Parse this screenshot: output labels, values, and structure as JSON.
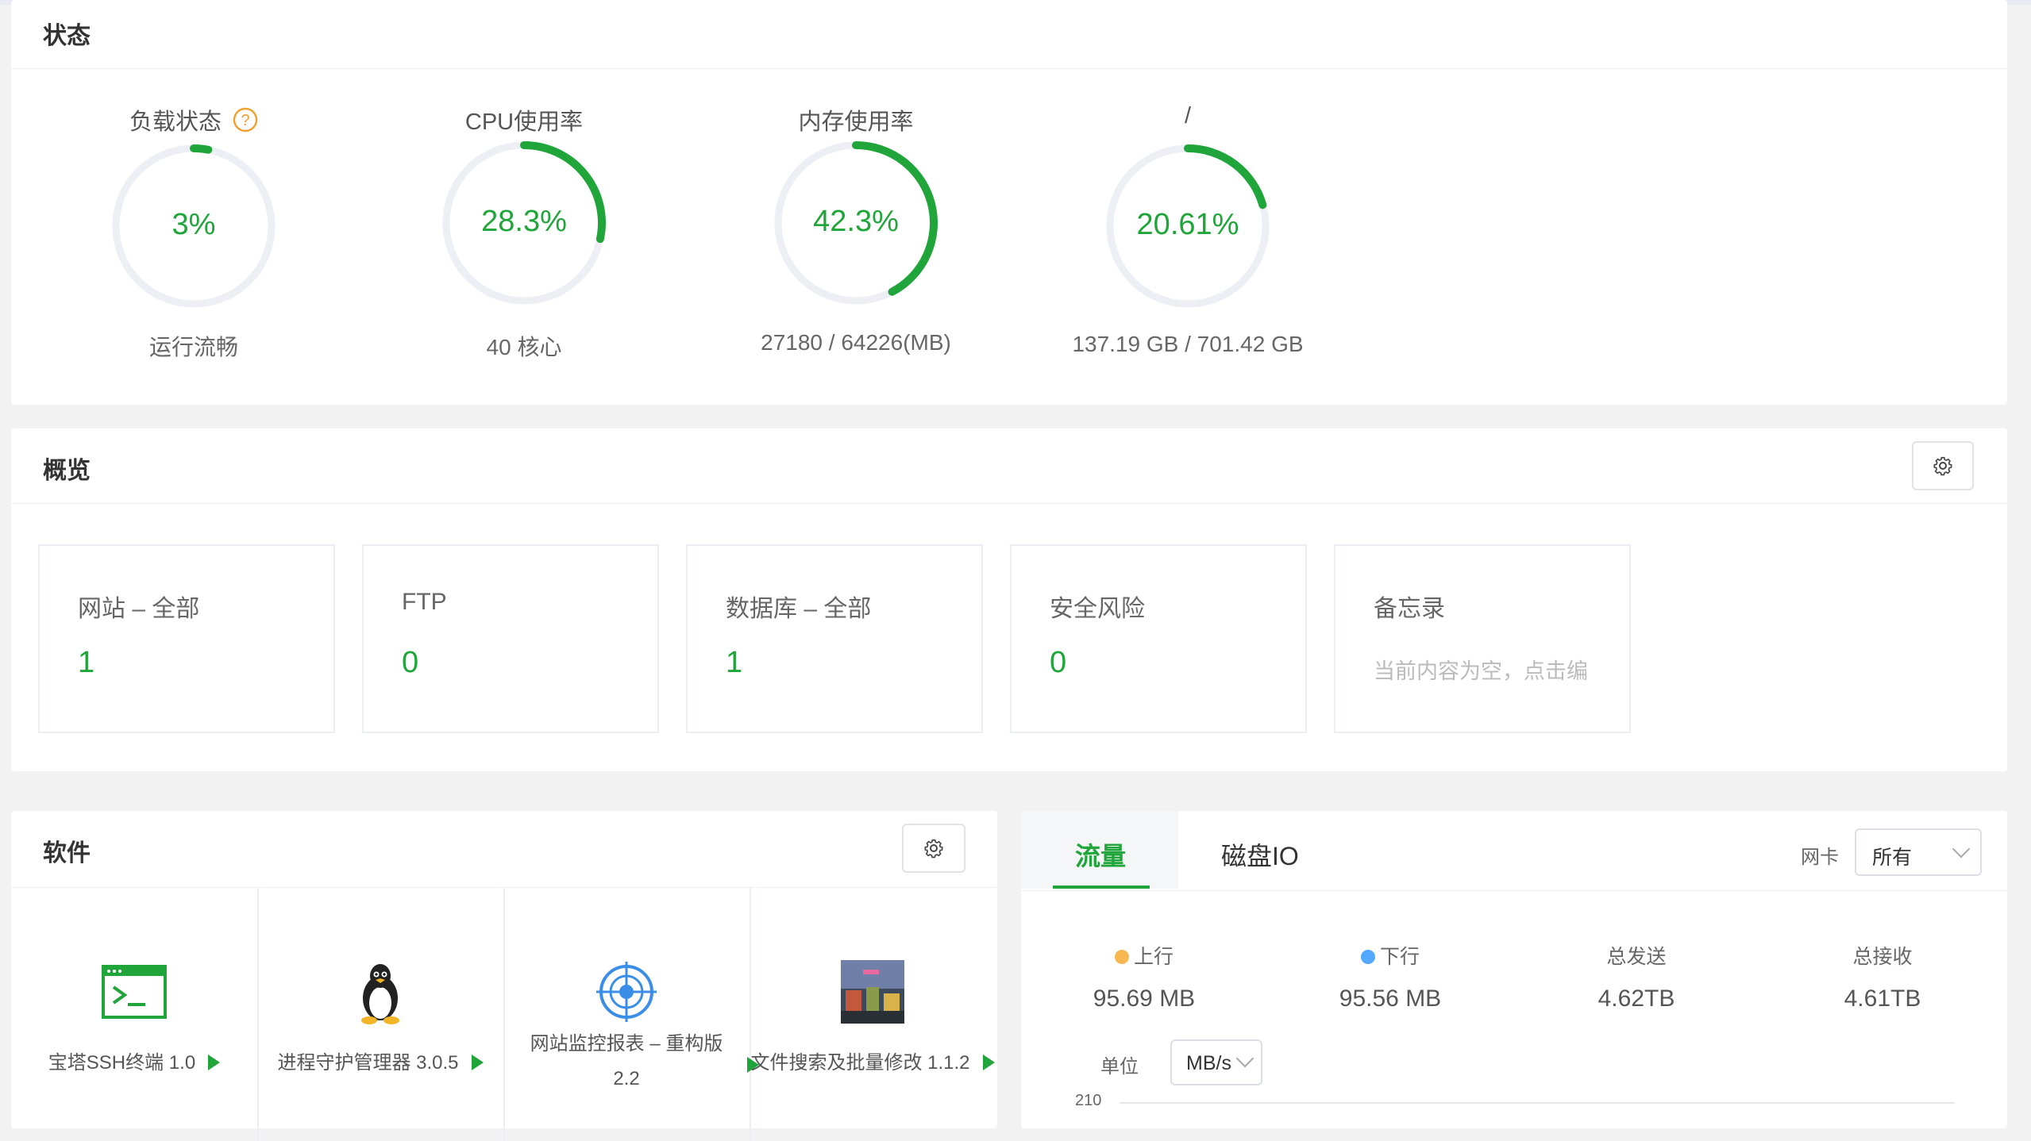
{
  "status": {
    "title": "状态",
    "gauges": [
      {
        "label": "负载状态",
        "value": "3%",
        "sub": "运行流畅",
        "fraction": 0.03,
        "has_help": true
      },
      {
        "label": "CPU使用率",
        "value": "28.3%",
        "sub": "40 核心",
        "fraction": 0.283
      },
      {
        "label": "内存使用率",
        "value": "42.3%",
        "sub": "27180 / 64226(MB)",
        "fraction": 0.423
      },
      {
        "label": "/",
        "value": "20.61%",
        "sub": "137.19 GB / 701.42 GB",
        "fraction": 0.2061
      }
    ]
  },
  "overview": {
    "title": "概览",
    "cards": [
      {
        "title": "网站 – 全部",
        "value": "1"
      },
      {
        "title": "FTP",
        "value": "0"
      },
      {
        "title": "数据库 – 全部",
        "value": "1"
      },
      {
        "title": "安全风险",
        "value": "0"
      },
      {
        "title": "备忘录",
        "note": "当前内容为空，点击编"
      }
    ]
  },
  "software": {
    "title": "软件",
    "items": [
      {
        "name": "宝塔SSH终端 1.0",
        "icon": "terminal-icon"
      },
      {
        "name": "进程守护管理器 3.0.5",
        "icon": "linux-penguin-icon"
      },
      {
        "name": "网站监控报表 – 重构版",
        "name2": "2.2",
        "icon": "radar-icon"
      },
      {
        "name": "文件搜索及批量修改 1.1.2",
        "icon": "file-search-thumbnail"
      }
    ]
  },
  "traffic": {
    "tabs": [
      "流量",
      "磁盘IO"
    ],
    "nic_label": "网卡",
    "nic_value": "所有",
    "stats": [
      {
        "label": "上行",
        "value": "95.69 MB",
        "dot_color": "#f7b851"
      },
      {
        "label": "下行",
        "value": "95.56 MB",
        "dot_color": "#52a9ff"
      },
      {
        "label": "总发送",
        "value": "4.62TB"
      },
      {
        "label": "总接收",
        "value": "4.61TB"
      }
    ],
    "unit_label": "单位",
    "unit_value": "MB/s",
    "axis_first_tick": "210"
  },
  "colors": {
    "accent": "#20a53a",
    "ring_bg": "#eeeef5"
  }
}
